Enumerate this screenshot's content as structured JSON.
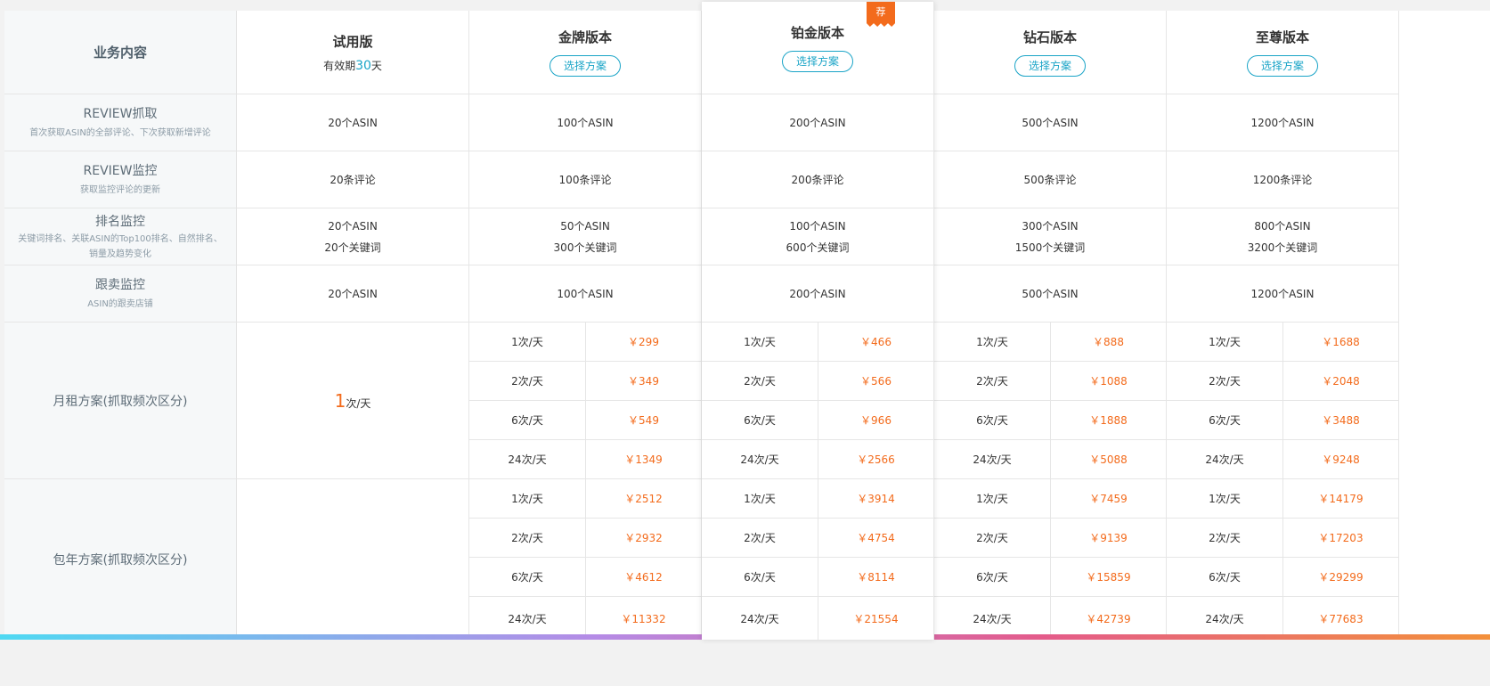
{
  "labels": {
    "header": "业务内容",
    "rows": [
      {
        "title": "REVIEW抓取",
        "desc": "首次获取ASIN的全部评论、下次获取新增评论"
      },
      {
        "title": "REVIEW监控",
        "desc": "获取监控评论的更新"
      },
      {
        "title": "排名监控",
        "desc": "关键词排名、关联ASIN的Top100排名、自然排名、销量及趋势变化"
      },
      {
        "title": "跟卖监控",
        "desc": "ASIN的跟卖店铺"
      },
      {
        "title": "月租方案(抓取频次区分)",
        "desc": ""
      },
      {
        "title": "包年方案(抓取频次区分)",
        "desc": ""
      }
    ]
  },
  "trial": {
    "name": "试用版",
    "validity_prefix": "有效期",
    "validity_days": "30",
    "validity_suffix": "天",
    "review_fetch": "20个ASIN",
    "review_monitor": "20条评论",
    "rank_asin": "20个ASIN",
    "rank_keywords": "20个关键词",
    "follow_sell": "20个ASIN",
    "freq_num": "1",
    "freq_unit": "次/天"
  },
  "choose_label": "选择方案",
  "recommend_badge": "荐",
  "plans": [
    {
      "name": "金牌版本",
      "review_fetch": "100个ASIN",
      "review_monitor": "100条评论",
      "rank_asin": "50个ASIN",
      "rank_keywords": "300个关键词",
      "follow_sell": "100个ASIN",
      "monthly": [
        {
          "freq": "1次/天",
          "price": "￥299"
        },
        {
          "freq": "2次/天",
          "price": "￥349"
        },
        {
          "freq": "6次/天",
          "price": "￥549"
        },
        {
          "freq": "24次/天",
          "price": "￥1349"
        }
      ],
      "yearly": [
        {
          "freq": "1次/天",
          "price": "￥2512"
        },
        {
          "freq": "2次/天",
          "price": "￥2932"
        },
        {
          "freq": "6次/天",
          "price": "￥4612"
        },
        {
          "freq": "24次/天",
          "price": "￥11332"
        }
      ]
    },
    {
      "name": "铂金版本",
      "review_fetch": "200个ASIN",
      "review_monitor": "200条评论",
      "rank_asin": "100个ASIN",
      "rank_keywords": "600个关键词",
      "follow_sell": "200个ASIN",
      "monthly": [
        {
          "freq": "1次/天",
          "price": "￥466"
        },
        {
          "freq": "2次/天",
          "price": "￥566"
        },
        {
          "freq": "6次/天",
          "price": "￥966"
        },
        {
          "freq": "24次/天",
          "price": "￥2566"
        }
      ],
      "yearly": [
        {
          "freq": "1次/天",
          "price": "￥3914"
        },
        {
          "freq": "2次/天",
          "price": "￥4754"
        },
        {
          "freq": "6次/天",
          "price": "￥8114"
        },
        {
          "freq": "24次/天",
          "price": "￥21554"
        }
      ]
    },
    {
      "name": "钻石版本",
      "review_fetch": "500个ASIN",
      "review_monitor": "500条评论",
      "rank_asin": "300个ASIN",
      "rank_keywords": "1500个关键词",
      "follow_sell": "500个ASIN",
      "monthly": [
        {
          "freq": "1次/天",
          "price": "￥888"
        },
        {
          "freq": "2次/天",
          "price": "￥1088"
        },
        {
          "freq": "6次/天",
          "price": "￥1888"
        },
        {
          "freq": "24次/天",
          "price": "￥5088"
        }
      ],
      "yearly": [
        {
          "freq": "1次/天",
          "price": "￥7459"
        },
        {
          "freq": "2次/天",
          "price": "￥9139"
        },
        {
          "freq": "6次/天",
          "price": "￥15859"
        },
        {
          "freq": "24次/天",
          "price": "￥42739"
        }
      ]
    },
    {
      "name": "至尊版本",
      "review_fetch": "1200个ASIN",
      "review_monitor": "1200条评论",
      "rank_asin": "800个ASIN",
      "rank_keywords": "3200个关键词",
      "follow_sell": "1200个ASIN",
      "monthly": [
        {
          "freq": "1次/天",
          "price": "￥1688"
        },
        {
          "freq": "2次/天",
          "price": "￥2048"
        },
        {
          "freq": "6次/天",
          "price": "￥3488"
        },
        {
          "freq": "24次/天",
          "price": "￥9248"
        }
      ],
      "yearly": [
        {
          "freq": "1次/天",
          "price": "￥14179"
        },
        {
          "freq": "2次/天",
          "price": "￥17203"
        },
        {
          "freq": "6次/天",
          "price": "￥29299"
        },
        {
          "freq": "24次/天",
          "price": "￥77683"
        }
      ]
    }
  ]
}
